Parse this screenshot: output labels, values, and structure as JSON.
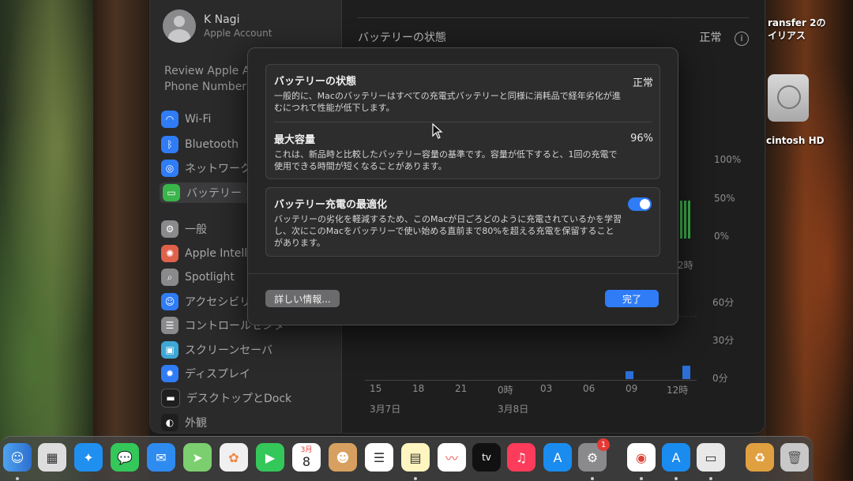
{
  "sidebar": {
    "account_name": "K Nagi",
    "account_sub": "Apple Account",
    "review_line1": "Review Apple A",
    "review_line2": "Phone Number",
    "items": [
      {
        "label": "Wi-Fi",
        "icon": "wifi-icon",
        "color": "#2f7cf6"
      },
      {
        "label": "Bluetooth",
        "icon": "bluetooth-icon",
        "color": "#2f7cf6"
      },
      {
        "label": "ネットワーク",
        "icon": "globe-icon",
        "color": "#2f7cf6"
      },
      {
        "label": "バッテリー",
        "icon": "battery-icon",
        "color": "#39b54a"
      },
      {
        "label": "一般",
        "icon": "gear-icon",
        "color": "#8a8a8d"
      },
      {
        "label": "Apple Intell",
        "icon": "apple-intelligence-icon",
        "color": "#e0604a"
      },
      {
        "label": "Spotlight",
        "icon": "search-icon",
        "color": "#8a8a8d"
      },
      {
        "label": "アクセシビリ",
        "icon": "accessibility-icon",
        "color": "#2f7cf6"
      },
      {
        "label": "コントロールセンタ",
        "icon": "control-center-icon",
        "color": "#8a8a8d"
      },
      {
        "label": "スクリーンセーバ",
        "icon": "screensaver-icon",
        "color": "#3fa7d6"
      },
      {
        "label": "ディスプレイ",
        "icon": "display-icon",
        "color": "#2f7cf6"
      },
      {
        "label": "デスクトップとDock",
        "icon": "dock-icon",
        "color": "#1e1e1f"
      },
      {
        "label": "外観",
        "icon": "appearance-icon",
        "color": "#1e1e1f"
      }
    ]
  },
  "main": {
    "battery_health_label": "バッテリーの状態",
    "battery_health_value": "正常",
    "info": "i",
    "pct_100": "100%",
    "pct_50": "50%",
    "pct_0": "0%",
    "hour_label": "2時",
    "min_60": "60分",
    "min_30": "30分",
    "min_0": "0分",
    "x_ticks": [
      "15",
      "18",
      "21",
      "0時",
      "03",
      "06",
      "09",
      "12時"
    ],
    "date1": "3月7日",
    "date2": "3月8日"
  },
  "modal": {
    "health_title": "バッテリーの状態",
    "health_value": "正常",
    "health_desc": "一般的に、Macのバッテリーはすべての充電式バッテリーと同様に消耗品で経年劣化が進むにつれて性能が低下します。",
    "capacity_title": "最大容量",
    "capacity_value": "96%",
    "capacity_desc": "これは、新品時と比較したバッテリー容量の基準です。容量が低下すると、1回の充電で使用できる時間が短くなることがあります。",
    "optimize_title": "バッテリー充電の最適化",
    "optimize_desc": "バッテリーの劣化を軽減するため、このMacが日ごろどのように充電されているかを学習し、次にこのMacをバッテリーで使い始める直前まで80%を超える充電を保留することがあります。",
    "optimize_on": true,
    "details_button": "詳しい情報...",
    "done_button": "完了"
  },
  "desktop": {
    "transfer_label_1": "ransfer 2の",
    "transfer_label_2": "イリアス",
    "hd_label": "cintosh HD"
  },
  "dock": {
    "calendar_month": "3月",
    "calendar_day": "8",
    "settings_badge": "1",
    "tv_label": "tv"
  }
}
